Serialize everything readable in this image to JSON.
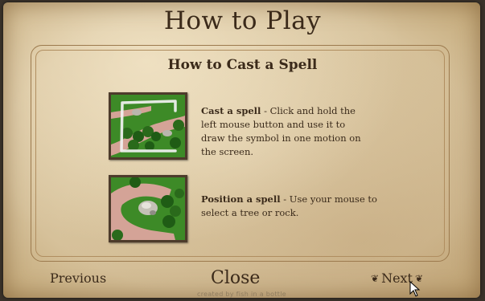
{
  "dialog": {
    "title": "How to Play",
    "section_heading": "How to Cast a Spell"
  },
  "instructions": [
    {
      "term": "Cast a spell",
      "text": " - Click and hold the left mouse button and use it to draw the symbol in one motion on the screen."
    },
    {
      "term": "Position a spell",
      "text": " - Use your mouse to select a tree or rock."
    }
  ],
  "footer": {
    "previous_label": "Previous",
    "close_label": "Close",
    "next_label": "Next",
    "credit": "created by fish in a bottle"
  },
  "colors": {
    "parchment": "#d6c19a",
    "ink": "#3b2a1a",
    "frame": "#9c7a4e",
    "grass": "#3f8a2a",
    "path": "#d09a8c"
  }
}
